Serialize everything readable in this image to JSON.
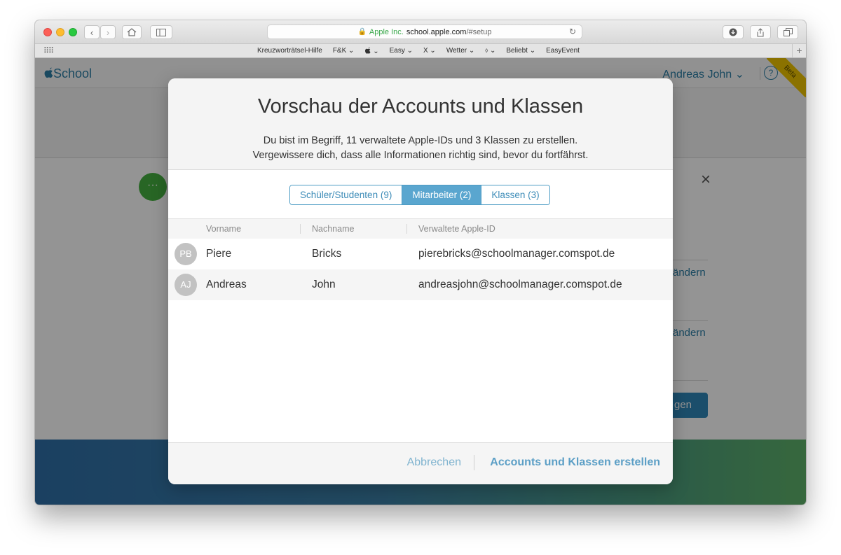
{
  "browser": {
    "address": {
      "corp": "Apple Inc.",
      "domain": "school.apple.com",
      "path": "/#setup"
    },
    "bookmarks": [
      "Kreuzworträtsel-Hilfe",
      "F&K ⌄",
      " ⌄",
      "Easy ⌄",
      "X ⌄",
      "Wetter ⌄",
      "⌄",
      "Beliebt ⌄",
      "EasyEvent"
    ],
    "colors": {
      "close": "#fc5f57",
      "minimize": "#fdbc2e",
      "zoom": "#29c940"
    }
  },
  "app": {
    "logo": "School",
    "user": "Andreas John ⌄",
    "help": "?",
    "beta": "Beta",
    "background": {
      "dots": "···",
      "close": "×",
      "link1": "ändern",
      "link2": "ändern",
      "button": "gen"
    }
  },
  "dialog": {
    "title": "Vorschau der Accounts und Klassen",
    "subtitle_line1": "Du bist im Begriff, 11 verwaltete Apple-IDs und 3 Klassen zu erstellen.",
    "subtitle_line2": "Vergewissere dich, dass alle Informationen richtig sind, bevor du fortfährst.",
    "tabs": [
      {
        "label": "Schüler/Studenten (9)",
        "active": false
      },
      {
        "label": "Mitarbeiter (2)",
        "active": true
      },
      {
        "label": "Klassen (3)",
        "active": false
      }
    ],
    "columns": [
      "Vorname",
      "Nachname",
      "Verwaltete Apple-ID"
    ],
    "rows": [
      {
        "initials": "PB",
        "first": "Piere",
        "last": "Bricks",
        "apple_id": "pierebricks@schoolmanager.comspot.de"
      },
      {
        "initials": "AJ",
        "first": "Andreas",
        "last": "John",
        "apple_id": "andreasjohn@schoolmanager.comspot.de"
      }
    ],
    "cancel_label": "Abbrechen",
    "create_label": "Accounts und Klassen erstellen"
  }
}
